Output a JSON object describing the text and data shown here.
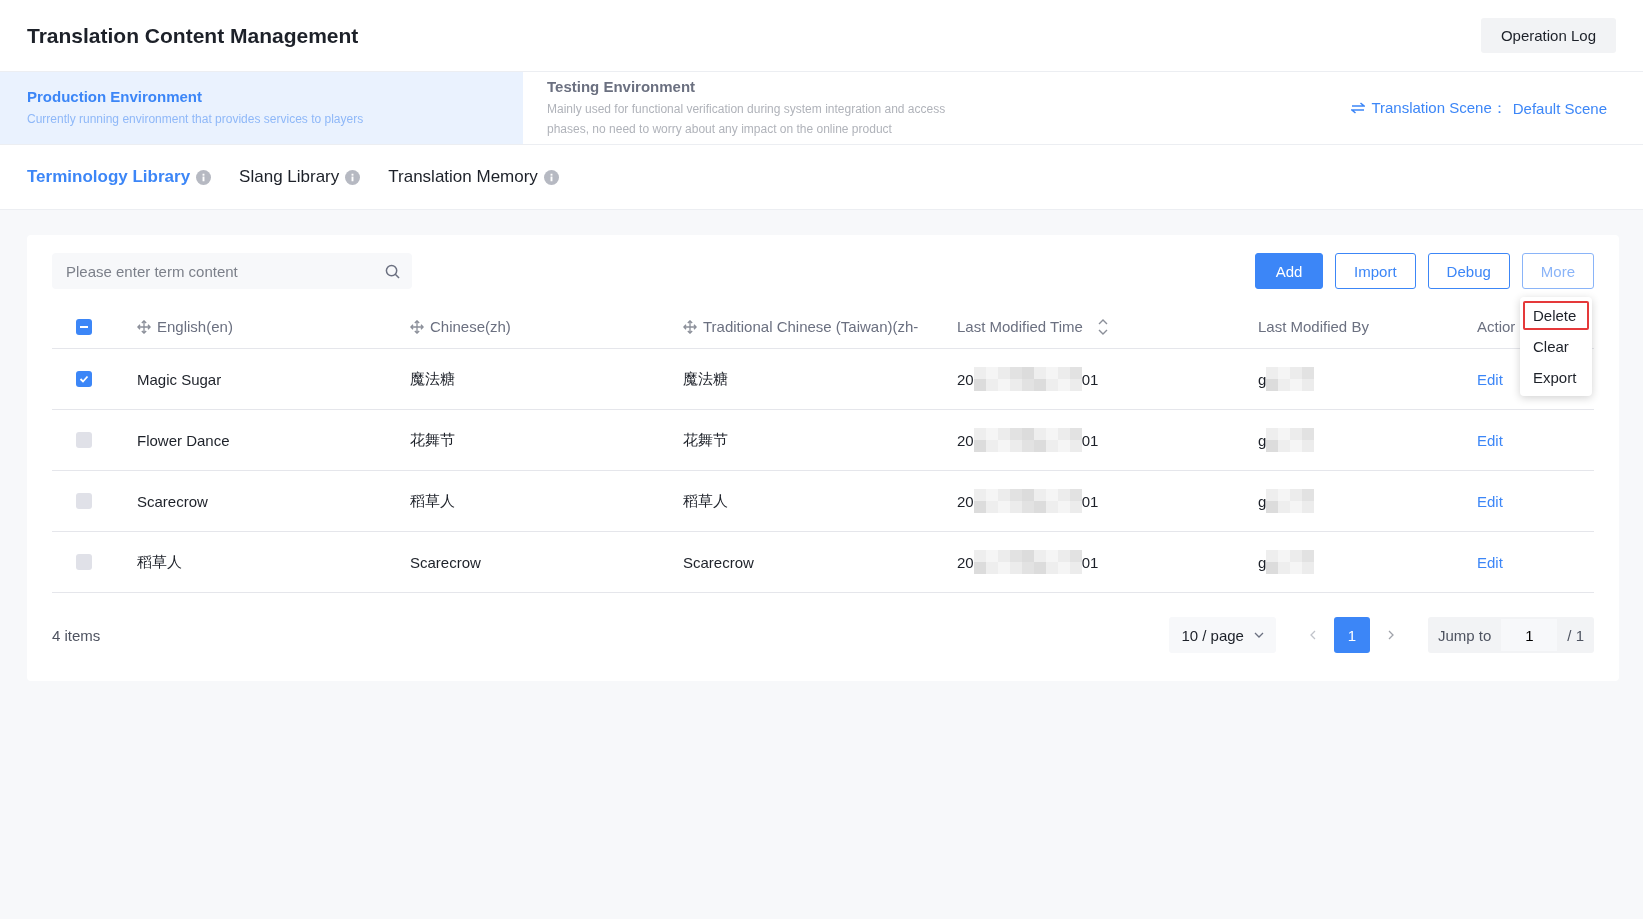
{
  "header": {
    "title": "Translation Content Management",
    "log_button": "Operation Log"
  },
  "environments": [
    {
      "name": "Production Environment",
      "description": "Currently running environment that provides services to players",
      "selected": true
    },
    {
      "name": "Testing Environment",
      "description": "Mainly used for functional verification during system integration and access phases, no need to worry about any impact on the online product",
      "selected": false
    }
  ],
  "scene": {
    "label": "Translation Scene：",
    "value": "Default Scene"
  },
  "library_tabs": [
    {
      "label": "Terminology Library",
      "selected": true
    },
    {
      "label": "Slang Library",
      "selected": false
    },
    {
      "label": "Translation Memory",
      "selected": false
    }
  ],
  "search": {
    "placeholder": "Please enter term content"
  },
  "actions": [
    {
      "label": "Add",
      "kind": "primary"
    },
    {
      "label": "Import",
      "kind": "outline"
    },
    {
      "label": "Debug",
      "kind": "outline"
    },
    {
      "label": "More",
      "kind": "faded"
    }
  ],
  "more_menu": [
    {
      "label": "Delete",
      "highlighted": true
    },
    {
      "label": "Clear",
      "highlighted": false
    },
    {
      "label": "Export",
      "highlighted": false
    }
  ],
  "table": {
    "select_all": {
      "indeterminate": true
    },
    "columns": [
      {
        "label": "English(en)",
        "kind": "movable"
      },
      {
        "label": "Chinese(zh)",
        "kind": "movable"
      },
      {
        "label": "Traditional Chinese (Taiwan)(zh-",
        "kind": "movable"
      },
      {
        "label": "Last Modified Time",
        "kind": "sortable"
      },
      {
        "label": "Last Modified By",
        "kind": "plain"
      },
      {
        "label": "Actior",
        "kind": "plain"
      }
    ],
    "rows": [
      {
        "checked": true,
        "en": "Magic Sugar",
        "zh": "魔法糖",
        "zh_tw": "魔法糖",
        "time_start": "20",
        "time_end": "01",
        "by_start": "g",
        "action": "Edit"
      },
      {
        "checked": false,
        "en": "Flower Dance",
        "zh": "花舞节",
        "zh_tw": "花舞节",
        "time_start": "20",
        "time_end": "01",
        "by_start": "g",
        "action": "Edit"
      },
      {
        "checked": false,
        "en": "Scarecrow",
        "zh": "稻草人",
        "zh_tw": "稻草人",
        "time_start": "20",
        "time_end": "01",
        "by_start": "g",
        "action": "Edit"
      },
      {
        "checked": false,
        "en": "稻草人",
        "zh": "Scarecrow",
        "zh_tw": "Scarecrow",
        "time_start": "20",
        "time_end": "01",
        "by_start": "g",
        "action": "Edit"
      }
    ]
  },
  "pagination": {
    "total": "4 items",
    "page_size": "10 / page",
    "pages": [
      {
        "label": "1",
        "selected": true
      }
    ],
    "jump_label": "Jump to",
    "jump_value": "1",
    "page_count": "/ 1"
  }
}
